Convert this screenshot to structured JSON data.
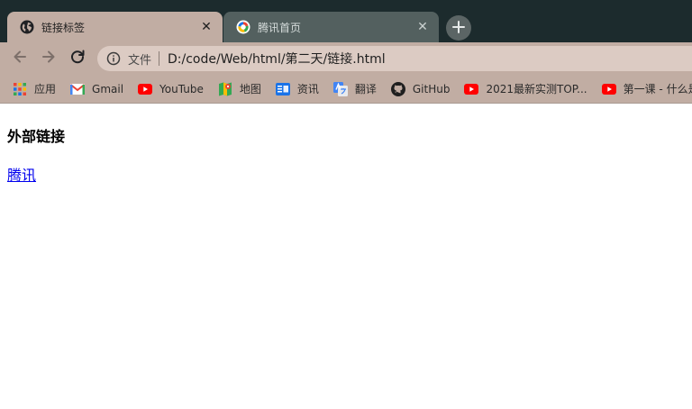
{
  "tabs": [
    {
      "title": "链接标签",
      "active": true,
      "icon": "globe-icon"
    },
    {
      "title": "腾讯首页",
      "active": false,
      "icon": "tencent-logo-icon"
    }
  ],
  "toolbar": {
    "omnibox": {
      "scheme_label": "文件",
      "url": "D:/code/Web/html/第二天/链接.html"
    }
  },
  "bookmarks": [
    {
      "label": "应用",
      "icon": "apps-grid-icon"
    },
    {
      "label": "Gmail",
      "icon": "gmail-icon"
    },
    {
      "label": "YouTube",
      "icon": "youtube-icon"
    },
    {
      "label": "地图",
      "icon": "maps-icon"
    },
    {
      "label": "资讯",
      "icon": "news-icon"
    },
    {
      "label": "翻译",
      "icon": "translate-icon"
    },
    {
      "label": "GitHub",
      "icon": "github-icon"
    },
    {
      "label": "2021最新实测TOP...",
      "icon": "youtube-icon"
    },
    {
      "label": "第一课 - 什么是",
      "icon": "youtube-icon"
    }
  ],
  "page": {
    "heading": "外部链接",
    "link_text": "腾讯"
  },
  "colors": {
    "tabstrip_bg": "#1c2b2d",
    "active_tab_bg": "#c1ada3",
    "inactive_tab_bg": "#53605f",
    "omnibox_bg": "#dccbc3",
    "link": "#0000ee"
  }
}
